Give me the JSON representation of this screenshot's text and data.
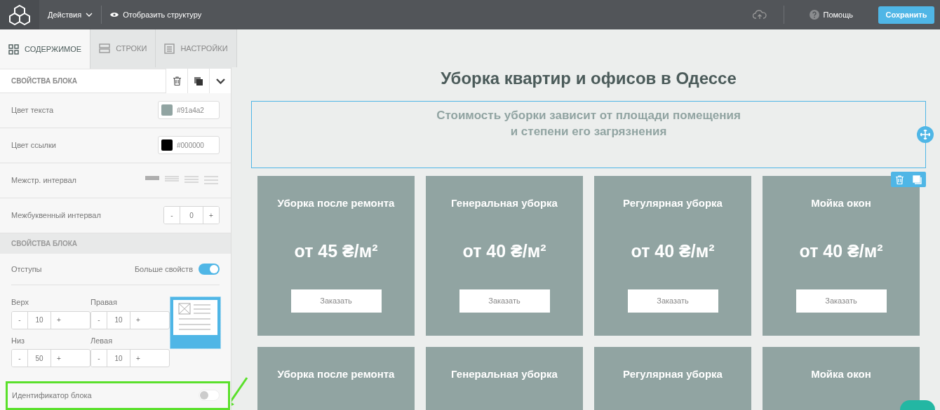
{
  "topbar": {
    "actions_menu": "Действия",
    "structure_button": "Отобразить структуру",
    "help": "Помощь",
    "save_button": "Сохранить"
  },
  "tabs": [
    {
      "kind": "grid",
      "label": "СОДЕРЖИМОЕ",
      "selected": true
    },
    {
      "kind": "rows",
      "label": "СТРОКИ",
      "selected": false
    },
    {
      "kind": "settings",
      "label": "НАСТРОЙКИ",
      "selected": false
    }
  ],
  "block_properties": {
    "title": "СВОЙСТВА БЛОКА",
    "fields": [
      {
        "kind": "color",
        "label": "Цвет текста",
        "value": "#91a4a2",
        "color": "#91a4a2"
      },
      {
        "kind": "color",
        "label": "Цвет ссылки",
        "value": "#000000",
        "color": "#000000"
      },
      {
        "kind": "spacing",
        "label": "Межстр. интервал",
        "options": [
          {
            "selected": true
          },
          {
            "selected": false
          },
          {
            "selected": false
          },
          {
            "selected": false
          }
        ]
      },
      {
        "kind": "stepper",
        "label": "Межбуквенный интервал",
        "minus": "-",
        "value": "0",
        "plus": "+"
      }
    ]
  },
  "layout_properties": {
    "title": "СВОЙСТВА БЛОКА",
    "padding_label": "Отступы",
    "more_label": "Больше свойств",
    "more_on": true,
    "steppers": [
      {
        "label": "Верх",
        "minus": "-",
        "value": "10",
        "plus": "+"
      },
      {
        "label": "Правая",
        "minus": "-",
        "value": "10",
        "plus": "+"
      },
      {
        "label": "Низ",
        "minus": "-",
        "value": "50",
        "plus": "+"
      },
      {
        "label": "Левая",
        "minus": "-",
        "value": "10",
        "plus": "+"
      }
    ],
    "block_id": {
      "label": "Идентификатор блока",
      "on": false,
      "highlighted": true
    }
  },
  "canvas": {
    "title": "Уборка квартир и офисов в Одессе",
    "subtitle_lines": [
      "Стоимость уборки зависит от площади помещения",
      "и степени его загрязнения"
    ],
    "subtitle_selected": true,
    "cards": [
      {
        "title": "Уборка после ремонта",
        "price": "от 45 ₴/м²",
        "button": "Заказать"
      },
      {
        "title": "Генеральная уборка",
        "price": "от 40 ₴/м²",
        "button": "Заказать"
      },
      {
        "title": "Регулярная уборка",
        "price": "от 40 ₴/м²",
        "button": "Заказать"
      },
      {
        "title": "Мойка окон",
        "price": "от 40 ₴/м²",
        "button": "Заказать"
      }
    ],
    "cards_row_2": [
      {
        "title": "Уборка после ремонта"
      },
      {
        "title": "Генеральная уборка"
      },
      {
        "title": "Регулярная уборка"
      },
      {
        "title": "Мойка окон"
      }
    ]
  }
}
